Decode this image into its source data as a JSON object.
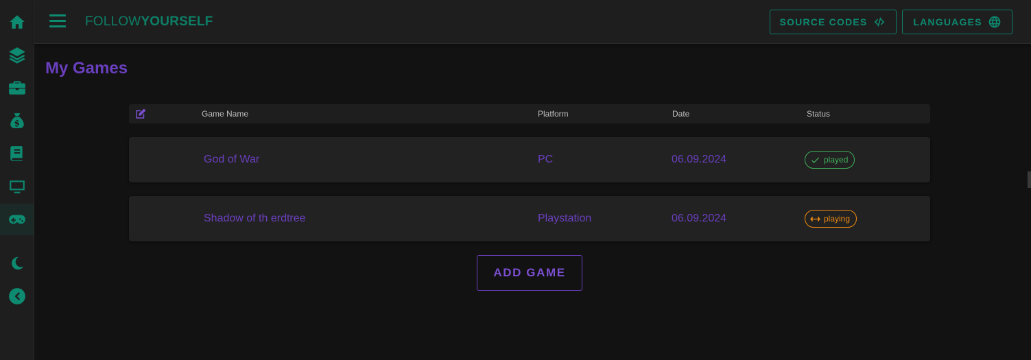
{
  "sidebar": {
    "items": [
      {
        "icon": "home-icon"
      },
      {
        "icon": "layers-icon"
      },
      {
        "icon": "briefcase-icon"
      },
      {
        "icon": "money-bag-icon"
      },
      {
        "icon": "book-icon"
      },
      {
        "icon": "monitor-icon"
      },
      {
        "icon": "gamepad-icon",
        "active": true
      },
      {
        "icon": "moon-icon"
      },
      {
        "icon": "collapse-arrow-icon"
      }
    ]
  },
  "header": {
    "brand_light": "FOLLOW",
    "brand_bold": "YOURSELF",
    "source_codes_label": "SOURCE CODES",
    "languages_label": "LANGUAGES"
  },
  "page": {
    "title": "My Games"
  },
  "table": {
    "columns": [
      "Game Name",
      "Platform",
      "Date",
      "Status"
    ],
    "rows": [
      {
        "name": "God of War",
        "platform": "PC",
        "date": "06.09.2024",
        "status": "played"
      },
      {
        "name": "Shadow of th erdtree",
        "platform": "Playstation",
        "date": "06.09.2024",
        "status": "playing"
      }
    ]
  },
  "actions": {
    "add_game_label": "ADD GAME"
  },
  "colors": {
    "accent_green": "#0d8a70",
    "accent_purple": "#6a3fbf",
    "played": "#3fb05a",
    "playing": "#f08a12",
    "background": "#121212"
  }
}
